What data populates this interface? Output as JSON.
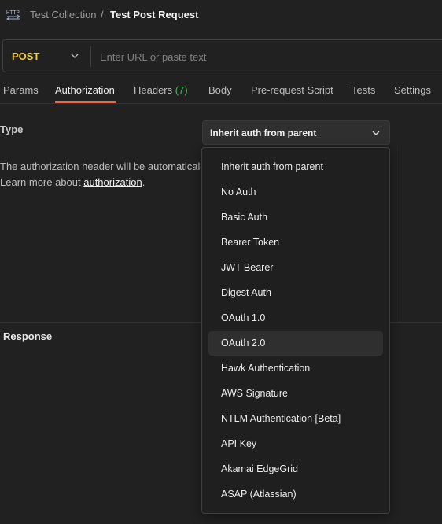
{
  "breadcrumb": {
    "collection": "Test Collection",
    "separator": "/",
    "request": "Test Post Request"
  },
  "request": {
    "method": "POST",
    "url_value": "",
    "url_placeholder": "Enter URL or paste text"
  },
  "tabs": [
    {
      "label": "Params"
    },
    {
      "label": "Authorization",
      "active": true
    },
    {
      "label": "Headers",
      "count": "(7)"
    },
    {
      "label": "Body"
    },
    {
      "label": "Pre-request Script"
    },
    {
      "label": "Tests"
    },
    {
      "label": "Settings"
    }
  ],
  "auth": {
    "type_label": "Type",
    "selected_type": "Inherit auth from parent",
    "description_line1": "The authorization header will be automatically generated when you send the request.",
    "description_line2_prefix": "Learn more about ",
    "description_link": "authorization",
    "description_line2_suffix": "."
  },
  "dropdown": {
    "hovered_item": "OAuth 2.0",
    "items": [
      "Inherit auth from parent",
      "No Auth",
      "Basic Auth",
      "Bearer Token",
      "JWT Bearer",
      "Digest Auth",
      "OAuth 1.0",
      "OAuth 2.0",
      "Hawk Authentication",
      "AWS Signature",
      "NTLM Authentication [Beta]",
      "API Key",
      "Akamai EdgeGrid",
      "ASAP (Atlassian)"
    ]
  },
  "response": {
    "label": "Response"
  },
  "colors": {
    "background": "#212121",
    "method_post": "#f4cf45",
    "active_tab_underline": "#e8694a",
    "headers_count": "#4fb360"
  },
  "icons": {
    "app": "http-icon",
    "method_dropdown": "chevron-down-icon",
    "type_dropdown": "chevron-down-icon"
  }
}
